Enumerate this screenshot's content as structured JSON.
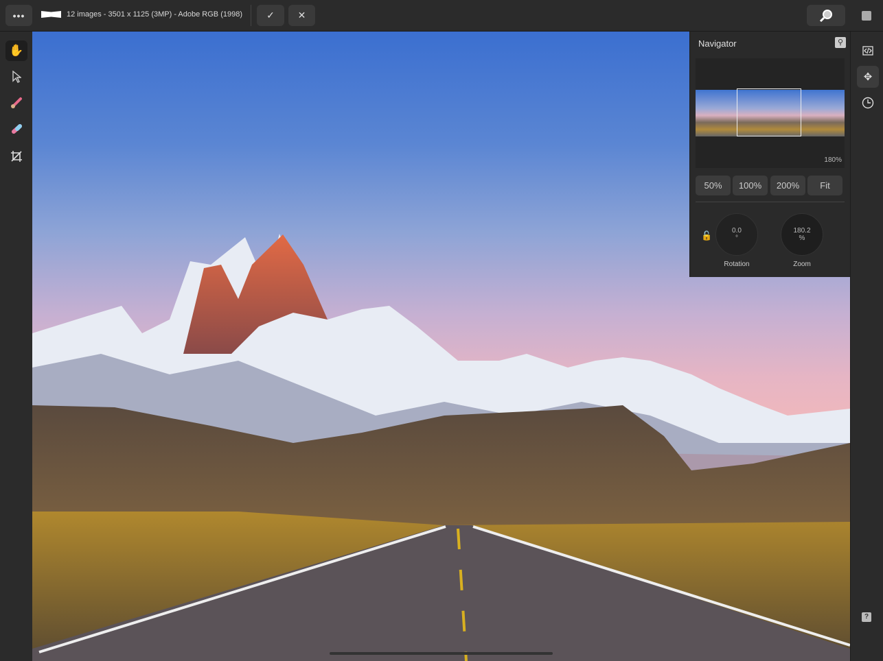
{
  "topbar": {
    "menu_label": "•••",
    "doc_info": "12 images - 3501 x 1125 (3MP) - Adobe RGB (1998)",
    "apply_label": "✓",
    "cancel_label": "✕"
  },
  "navigator": {
    "title": "Navigator",
    "view_zoom": "180%",
    "zoom_buttons": [
      "50%",
      "100%",
      "200%",
      "Fit"
    ],
    "rotation": {
      "value": "0.0",
      "unit": "°",
      "label": "Rotation"
    },
    "zoom": {
      "value": "180.2",
      "unit": "%",
      "label": "Zoom"
    }
  },
  "help_label": "?"
}
